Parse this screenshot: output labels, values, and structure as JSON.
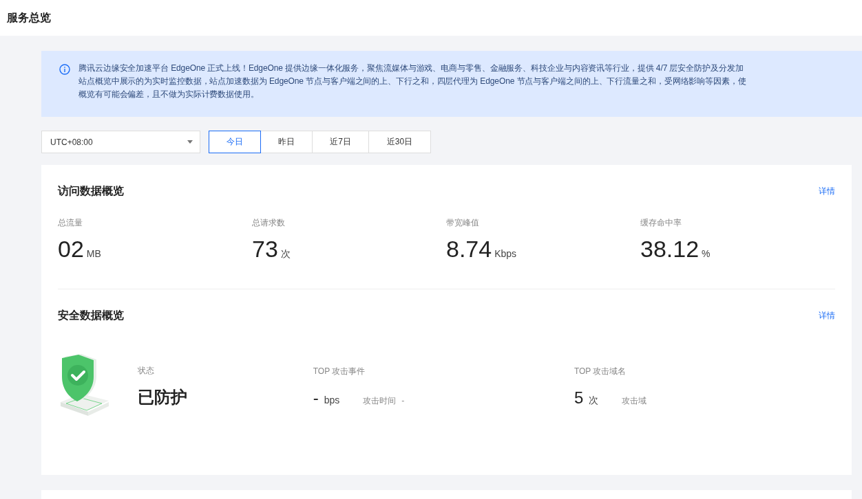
{
  "page": {
    "title": "服务总览"
  },
  "notice": {
    "lines": [
      "腾讯云边缘安全加速平台 EdgeOne 正式上线！EdgeOne 提供边缘一体化服务，聚焦流媒体与游戏、电商与零售、金融服务、科技企业与内容资讯等行业，提供 4/7 层安全防护及分发加",
      "站点概览中展示的为实时监控数据，站点加速数据为 EdgeOne 节点与客户端之间的上、下行之和，四层代理为 EdgeOne 节点与客户端之间的上、下行流量之和，受网络影响等因素，使",
      "概览有可能会偏差，且不做为实际计费数据使用。"
    ]
  },
  "timezone": {
    "value": "UTC+08:00"
  },
  "ranges": [
    {
      "label": "今日",
      "selected": true
    },
    {
      "label": "昨日",
      "selected": false
    },
    {
      "label": "近7日",
      "selected": false
    },
    {
      "label": "近30日",
      "selected": false
    }
  ],
  "access": {
    "title": "访问数据概览",
    "link": "详情",
    "metrics": [
      {
        "label": "总流量",
        "value": "02",
        "unit": "MB"
      },
      {
        "label": "总请求数",
        "value": "73",
        "unit": "次"
      },
      {
        "label": "带宽峰值",
        "value": "8.74",
        "unit": "Kbps"
      },
      {
        "label": "缓存命中率",
        "value": "38.12",
        "unit": "%"
      }
    ]
  },
  "security": {
    "title": "安全数据概览",
    "link": "详情",
    "status": {
      "label": "状态",
      "value": "已防护"
    },
    "top_event": {
      "label": "TOP 攻击事件",
      "value": "-",
      "unit": "bps",
      "meta_label": "攻击时间",
      "meta_value": "-"
    },
    "top_domain": {
      "label": "TOP 攻击域名",
      "value": "5",
      "unit": "次",
      "meta_label": "攻击域"
    }
  }
}
